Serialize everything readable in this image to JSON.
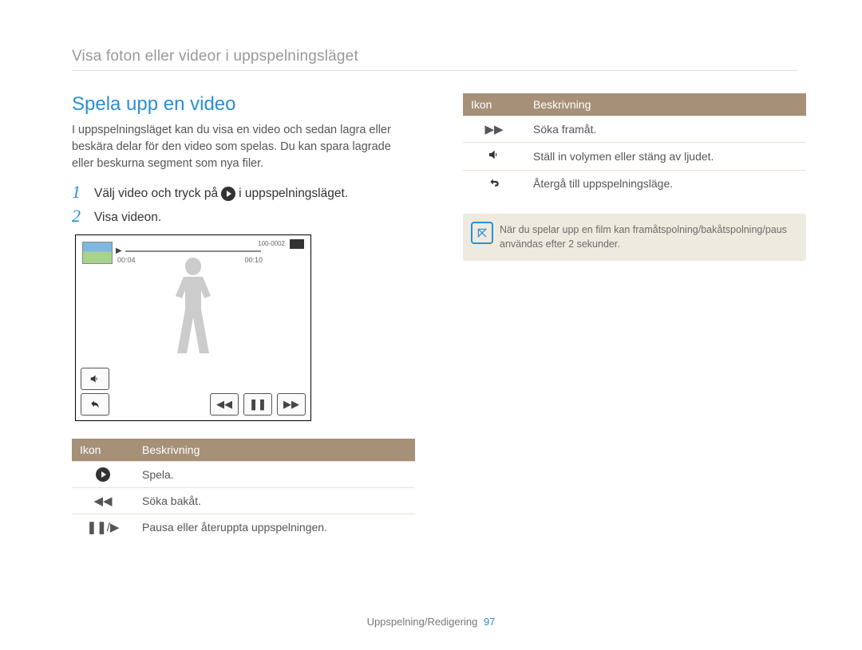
{
  "breadcrumb": "Visa foton eller videor i uppspelningsläget",
  "title": "Spela upp en video",
  "intro": "I uppspelningsläget kan du visa en video och sedan lagra eller beskära delar för den video som spelas. Du kan spara lagrade eller beskurna segment som nya filer.",
  "steps": [
    {
      "num": "1",
      "pre": "Välj video och tryck på",
      "post": "i uppspelningsläget."
    },
    {
      "num": "2",
      "pre": "Visa videon.",
      "post": ""
    }
  ],
  "player": {
    "time_elapsed": "00:04",
    "time_total": "00:10",
    "file_no": "100-0002"
  },
  "table_left": {
    "headers": {
      "icon": "Ikon",
      "desc": "Beskrivning"
    },
    "rows": [
      {
        "icon": "play",
        "desc": "Spela."
      },
      {
        "icon": "rewind",
        "desc": "Söka bakåt."
      },
      {
        "icon": "pause-play",
        "desc": "Pausa eller återuppta uppspelningen."
      }
    ]
  },
  "table_right": {
    "headers": {
      "icon": "Ikon",
      "desc": "Beskrivning"
    },
    "rows": [
      {
        "icon": "fast-forward",
        "desc": "Söka framåt."
      },
      {
        "icon": "volume",
        "desc": "Ställ in volymen eller stäng av ljudet."
      },
      {
        "icon": "return",
        "desc": "Återgå till uppspelningsläge."
      }
    ]
  },
  "note": "När du spelar upp en film kan framåtspolning/bakåtspolning/paus användas efter 2 sekunder.",
  "footer": {
    "section": "Uppspelning/Redigering",
    "page": "97"
  }
}
